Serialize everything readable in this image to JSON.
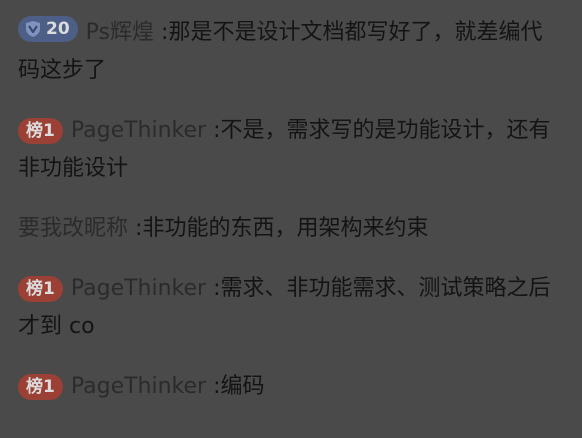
{
  "messages": [
    {
      "badge": {
        "type": "level",
        "icon": "v-shield-icon",
        "text": "20"
      },
      "username": "Ps辉煌",
      "separator": ":",
      "text": "那是不是设计文档都写好了，就差编代码这步了"
    },
    {
      "badge": {
        "type": "rank",
        "text": "榜1"
      },
      "username": "PageThinker",
      "separator": ":",
      "text": "不是，需求写的是功能设计，还有非功能设计"
    },
    {
      "badge": null,
      "username": "要我改昵称",
      "separator": ":",
      "text": "非功能的东西，用架构来约束"
    },
    {
      "badge": {
        "type": "rank",
        "text": "榜1"
      },
      "username": "PageThinker",
      "separator": ":",
      "text": "需求、非功能需求、测试策略之后才到 co"
    },
    {
      "badge": {
        "type": "rank",
        "text": "榜1"
      },
      "username": "PageThinker",
      "separator": ":",
      "text": "编码"
    }
  ],
  "colors": {
    "overlay_bg": "#4a4a4a",
    "level_badge": "#4d5f87",
    "rank_badge": "#9b4035"
  }
}
